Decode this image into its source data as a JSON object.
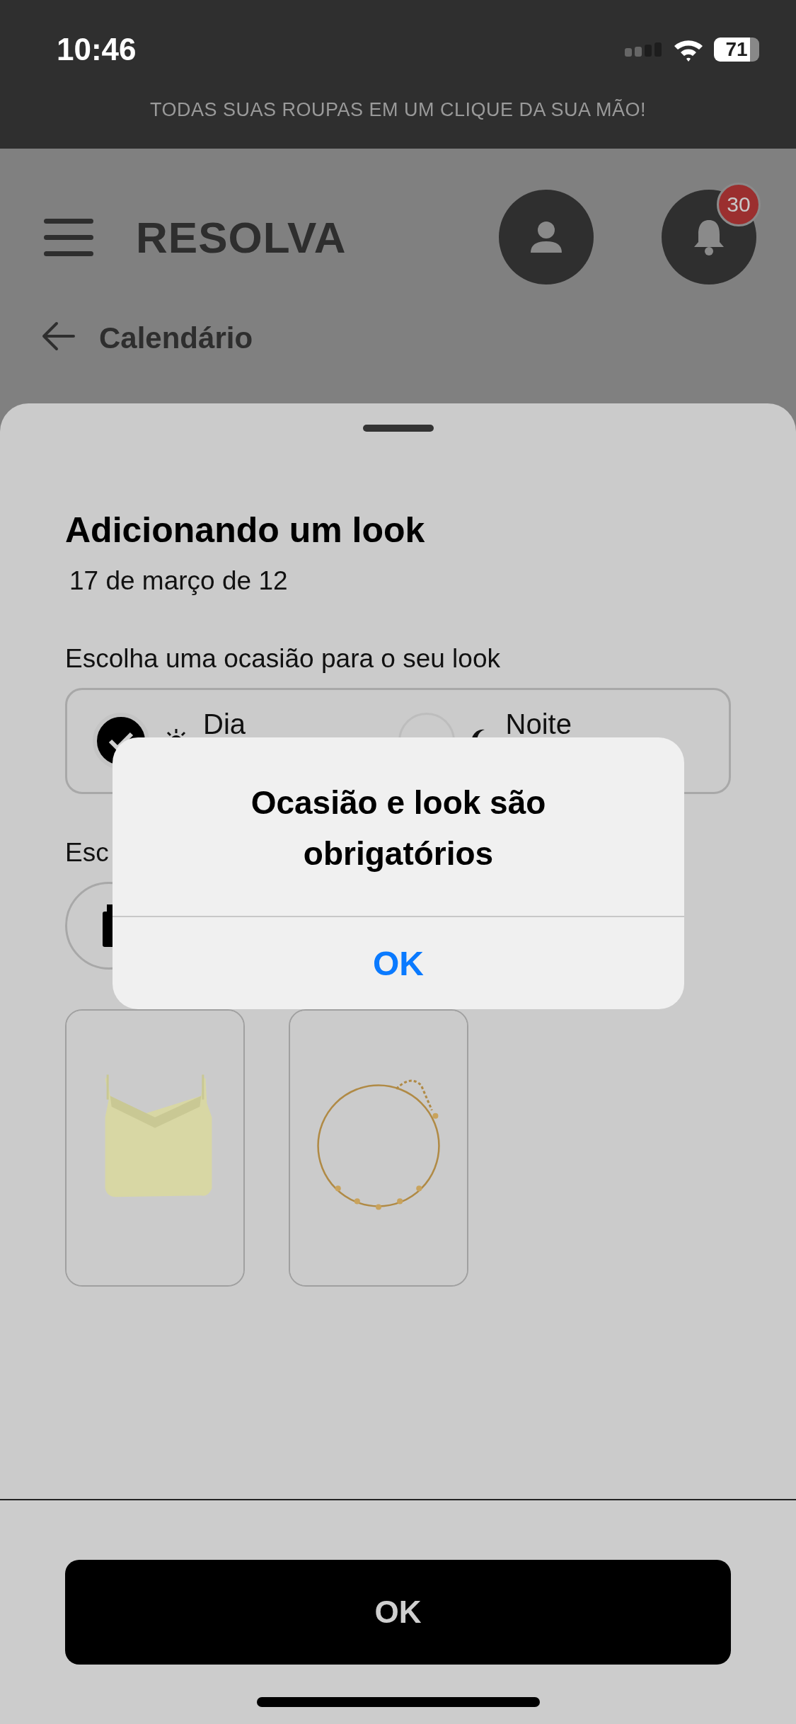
{
  "status_bar": {
    "time": "10:46",
    "battery": "71"
  },
  "tagline": "TODAS SUAS ROUPAS EM UM CLIQUE DA SUA MÃO!",
  "header": {
    "brand": "RESOLVA",
    "notifications_badge": "30"
  },
  "back": {
    "label": "Calendário"
  },
  "sheet": {
    "title": "Adicionando um look",
    "date": "17 de março de 12",
    "occasion_label": "Escolha uma ocasião para o seu look",
    "occasions": [
      {
        "label": "Dia",
        "kind": "day",
        "selected": true
      },
      {
        "label": "Noite",
        "kind": "night",
        "selected": false
      }
    ],
    "category_label": "Esc"
  },
  "alert": {
    "title": "Ocasião e look são obrigatórios",
    "button": "OK"
  },
  "footer": {
    "button": "OK"
  }
}
